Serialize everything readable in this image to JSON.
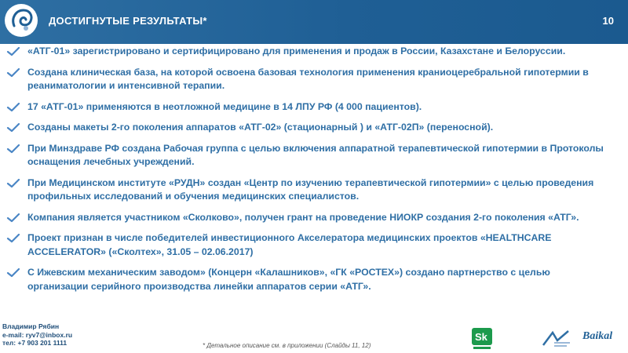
{
  "header": {
    "title": "ДОСТИГНУТЫЕ РЕЗУЛЬТАТЫ*",
    "page_number": "10"
  },
  "items": [
    "«АТГ-01» зарегистрировано и сертифицировано для применения и продаж в России, Казахстане и Белоруссии.",
    "Создана клиническая база, на которой освоена базовая технология применения краниоцеребральной гипотермии в реаниматологии и интенсивной терапии.",
    "17 «АТГ-01» применяются в неотложной медицине в 14 ЛПУ РФ (4 000 пациентов).",
    "Созданы макеты 2-го поколения аппаратов «АТГ-02» (стационарный ) и «АТГ-02П» (переносной).",
    "При Минздраве РФ создана Рабочая группа с целью включения аппаратной терапевтической гипотермии в Протоколы оснащения лечебных учреждений.",
    "При Медицинском институте «РУДН» создан «Центр по изучению терапевтической гипотермии» с целью проведения профильных исследований и обучения медицинских специалистов.",
    "Компания является участником «Сколково», получен грант на проведение НИОКР создания 2-го поколения «АТГ».",
    "Проект признан в числе победителей инвестиционного Акселератора медицинских проектов «HEALTHCARE ACCELERATOR» («Сколтех», 31.05 – 02.06.2017)",
    "С Ижевским механическим заводом» (Концерн «Калашников», «ГК «РОСТЕХ») создано партнерство с целью организации серийного производства линейки аппаратов серии «АТГ»."
  ],
  "footer": {
    "name": "Владимир Рябин",
    "email": "e-mail: ryv7@inbox.ru",
    "phone": "тел: +7 903 201 1111",
    "note": "* Детальное описание см. в приложении (Слайды 11, 12)",
    "baikal": "Baikal"
  },
  "colors": {
    "header": "#1f5f95",
    "text": "#2f6fa5",
    "check": "#4a86c5"
  }
}
